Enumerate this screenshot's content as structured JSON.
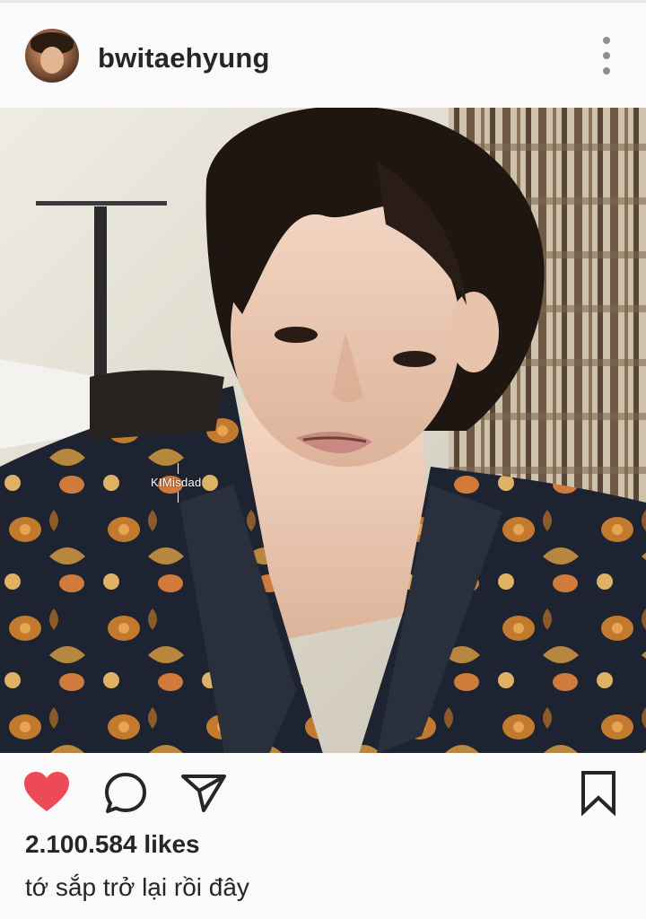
{
  "post": {
    "author": {
      "username": "bwitaehyung",
      "avatar_icon": "profile-avatar"
    },
    "header_menu_icon": "more-vertical-icon",
    "photo": {
      "description_icon": "post-photo",
      "watermark": "KIMisdad"
    },
    "actions": {
      "like_icon": "heart-filled-icon",
      "comment_icon": "comment-bubble-icon",
      "share_icon": "send-paper-plane-icon",
      "save_icon": "bookmark-icon",
      "liked": true,
      "like_color": "#ed4956"
    },
    "likes": "2.100.584 likes",
    "caption": "tớ sắp trở lại rồi đây"
  },
  "colors": {
    "background": "#fafafa",
    "text": "#262626",
    "like_red": "#ed4956",
    "menu_dots": "#8e8e8e"
  }
}
